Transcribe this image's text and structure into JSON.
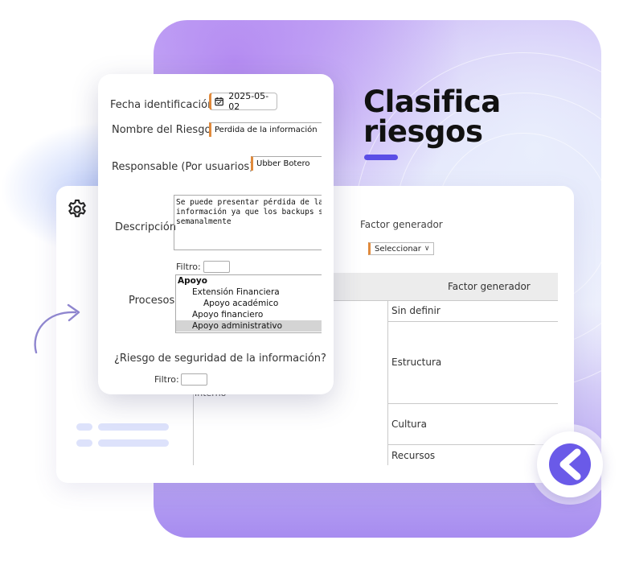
{
  "headline": {
    "line1": "Clasifica",
    "line2": "riesgos"
  },
  "form": {
    "fecha_label": "Fecha identificación",
    "fecha_value": "2025-05-02",
    "nombre_label": "Nombre del Riesgo",
    "nombre_value": "Perdida de la información",
    "responsable_label": "Responsable (Por usuarios)",
    "responsable_value": "Ubber Botero",
    "descripcion_label": "Descripción",
    "descripcion_value": "Se puede presentar pérdida de la\ninformación ya que los backups se re\nsemanalmente",
    "filtro_label": "Filtro:",
    "procesos_label": "Procesos",
    "procesos": [
      "Apoyo",
      "Extensión Financiera",
      "Apoyo académico",
      "Apoyo financiero",
      "Apoyo administrativo"
    ],
    "seguridad_label": "¿Riesgo de seguridad de la información?",
    "filtro2_label": "Filtro:"
  },
  "table": {
    "factor_label": "Factor generador",
    "factor_select": "Seleccionar",
    "header": "Factor generador",
    "left_partial": "Interno",
    "rows": [
      "Sin definir",
      "Estructura",
      "Cultura",
      "Recursos"
    ]
  },
  "icons": {
    "settings": "gear-icon",
    "calendar": "calendar-icon",
    "arrow": "curved-arrow-icon",
    "logo": "brand-logo-icon"
  },
  "colors": {
    "accent": "#5a4ee6",
    "field_accent": "#e08a3c",
    "logo": "#6a5ae8"
  }
}
